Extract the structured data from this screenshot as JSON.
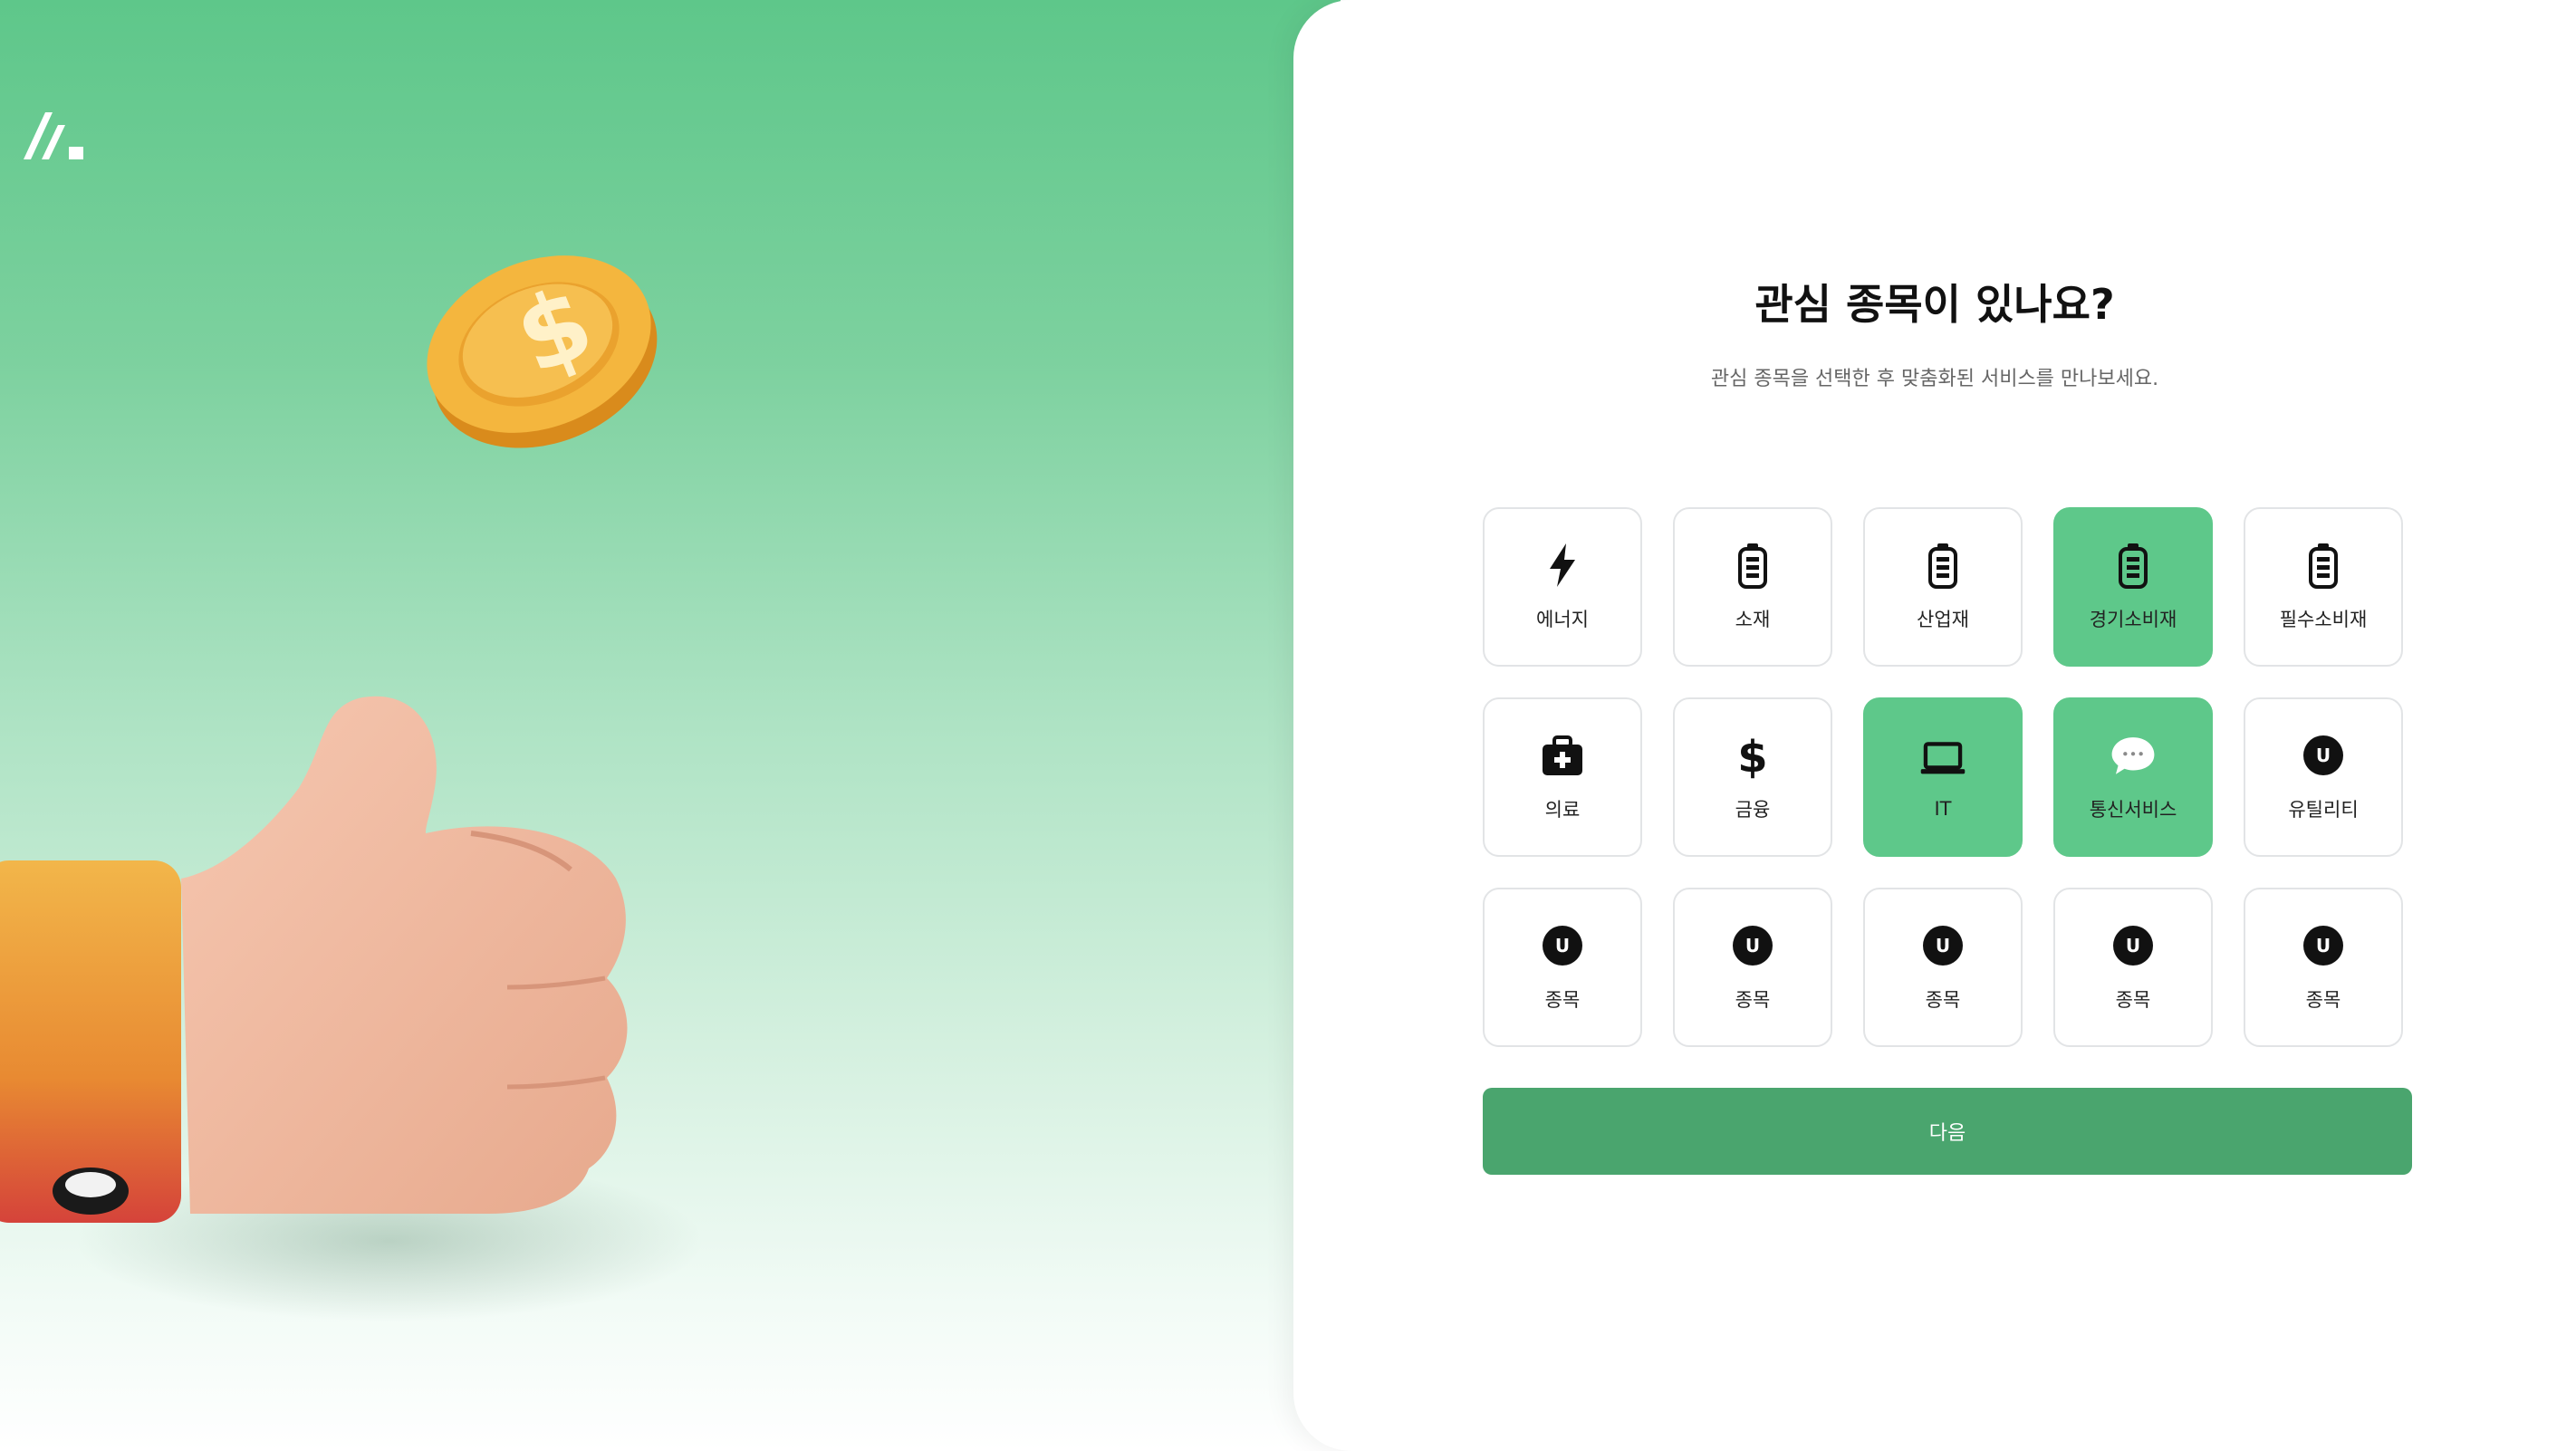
{
  "header": {
    "title": "관심 종목이 있나요?",
    "subtitle": "관심 종목을 선택한 후 맞춤화된 서비스를 만나보세요."
  },
  "categories": [
    {
      "label": "에너지",
      "icon": "lightning-icon",
      "selected": false
    },
    {
      "label": "소재",
      "icon": "battery-icon",
      "selected": false
    },
    {
      "label": "산업재",
      "icon": "battery-icon",
      "selected": false
    },
    {
      "label": "경기소비재",
      "icon": "battery-icon",
      "selected": true
    },
    {
      "label": "필수소비재",
      "icon": "battery-icon",
      "selected": false
    },
    {
      "label": "의료",
      "icon": "medical-kit-icon",
      "selected": false
    },
    {
      "label": "금융",
      "icon": "dollar-icon",
      "selected": false
    },
    {
      "label": "IT",
      "icon": "laptop-icon",
      "selected": true
    },
    {
      "label": "통신서비스",
      "icon": "speech-bubble-icon",
      "selected": true
    },
    {
      "label": "유틸리티",
      "icon": "u-badge-icon",
      "icon_text": "U",
      "selected": false
    },
    {
      "label": "종목",
      "icon": "u-badge-icon",
      "icon_text": "U",
      "selected": false
    },
    {
      "label": "종목",
      "icon": "u-badge-icon",
      "icon_text": "U",
      "selected": false
    },
    {
      "label": "종목",
      "icon": "u-badge-icon",
      "icon_text": "U",
      "selected": false
    },
    {
      "label": "종목",
      "icon": "u-badge-icon",
      "icon_text": "U",
      "selected": false
    },
    {
      "label": "종목",
      "icon": "u-badge-icon",
      "icon_text": "U",
      "selected": false
    }
  ],
  "actions": {
    "next_label": "다음"
  },
  "colors": {
    "accent": "#5ec88a",
    "button": "#4aa56e",
    "card_border": "#e2e4e6",
    "text": "#111111"
  }
}
